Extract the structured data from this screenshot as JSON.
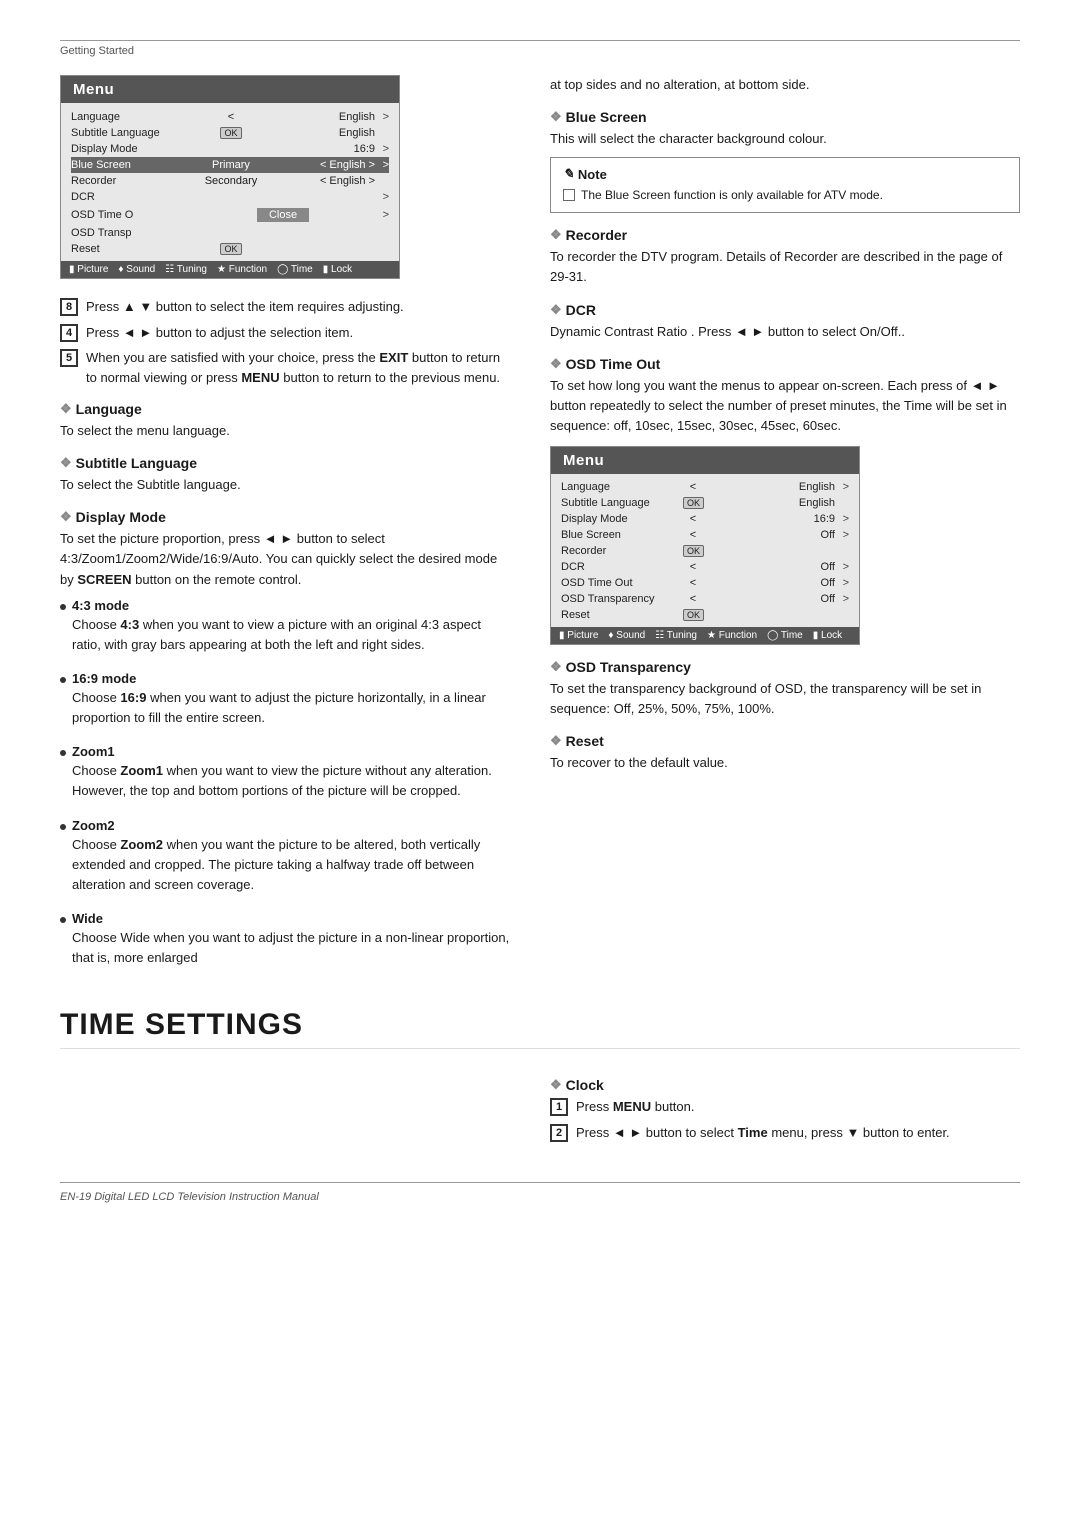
{
  "page": {
    "section_header": "Getting Started",
    "footer_text": "EN-19  Digital LED LCD Television Instruction Manual"
  },
  "menu1": {
    "title": "Menu",
    "rows": [
      {
        "label": "Language",
        "middle": "",
        "value": "English",
        "arrow": ">",
        "ok": false,
        "highlight": false
      },
      {
        "label": "Subtitle Language",
        "middle": "OK",
        "value": "English",
        "arrow": "",
        "ok": true,
        "highlight": false
      },
      {
        "label": "Display Mode",
        "middle": "",
        "value": "16:9",
        "arrow": ">",
        "ok": false,
        "highlight": false
      },
      {
        "label": "Blue Screen",
        "middle": "Primary",
        "value": "< English >",
        "arrow": ">",
        "ok": false,
        "highlight": true
      },
      {
        "label": "Recorder",
        "middle": "Secondary",
        "value": "< English >",
        "arrow": "",
        "ok": false,
        "highlight": false
      },
      {
        "label": "DCR",
        "middle": "",
        "value": "",
        "arrow": ">",
        "ok": false,
        "highlight": false
      },
      {
        "label": "OSD Time Out",
        "middle": "Close",
        "value": "",
        "arrow": ">",
        "ok": false,
        "highlight": false
      },
      {
        "label": "OSD Transparency",
        "middle": "",
        "value": "",
        "arrow": "",
        "ok": false,
        "highlight": false
      },
      {
        "label": "Reset",
        "middle": "OK",
        "value": "",
        "arrow": "",
        "ok": true,
        "highlight": false
      }
    ],
    "footer_items": [
      "Picture",
      "Sound",
      "Tuning",
      "Function",
      "Time",
      "Lock"
    ]
  },
  "steps": [
    {
      "num": "8",
      "text": "Press ▲ ▼ button to select the item requires adjusting."
    },
    {
      "num": "4",
      "text": "Press ◄ ► button to adjust the selection item."
    },
    {
      "num": "5",
      "text": "When you are satisfied with your choice, press the EXIT button to return to normal viewing or press MENU button to return to the previous menu."
    }
  ],
  "left_sections": [
    {
      "title": "Language",
      "body": "To select the menu language."
    },
    {
      "title": "Subtitle Language",
      "body": "To select the Subtitle language."
    },
    {
      "title": "Display Mode",
      "body": "To set the picture proportion, press ◄ ► button to select 4:3/Zoom1/Zoom2/Wide/16:9/Auto. You can quickly select the desired mode by SCREEN button on the remote control.",
      "sub_items": [
        {
          "title": "4:3 mode",
          "body": "Choose 4:3 when you want to view a picture with an original 4:3 aspect ratio, with gray bars appearing at both the left and right sides."
        },
        {
          "title": "16:9 mode",
          "body": "Choose 16:9 when you want to adjust the picture horizontally, in a linear proportion to fill the entire screen."
        },
        {
          "title": "Zoom1",
          "body": "Choose Zoom1 when you want to view the picture without any alteration. However, the top and bottom portions of the picture will be cropped."
        },
        {
          "title": "Zoom2",
          "body": "Choose Zoom2 when you want the picture to be altered, both vertically extended and cropped. The picture taking a halfway trade off between alteration and screen coverage."
        },
        {
          "title": "Wide",
          "body": "Choose Wide when you want to adjust the picture in a non-linear proportion, that is, more enlarged"
        }
      ]
    }
  ],
  "right_top_text": "at top sides and no alteration, at bottom side.",
  "right_sections": [
    {
      "title": "Blue Screen",
      "body": "This will select the character background colour.",
      "note": {
        "title": "Note",
        "items": [
          "The Blue Screen function is only available for ATV mode."
        ]
      }
    },
    {
      "title": "Recorder",
      "body": "To recorder the DTV program. Details of Recorder are described in the page of 29-31."
    },
    {
      "title": "DCR",
      "body": "Dynamic Contrast Ratio . Press ◄ ► button to select On/Off.."
    },
    {
      "title": "OSD Time Out",
      "body": "To set how long you want the menus to appear on-screen. Each press of ◄ ► button repeatedly to select the number of preset minutes, the Time will be set in sequence: off, 10sec, 15sec, 30sec, 45sec, 60sec."
    },
    {
      "title": "OSD Transparency",
      "body": "To set the transparency background of OSD, the transparency will be set in sequence: Off, 25%, 50%, 75%, 100%."
    },
    {
      "title": "Reset",
      "body": "To recover to the default value."
    }
  ],
  "menu2": {
    "title": "Menu",
    "rows": [
      {
        "label": "Language",
        "middle": "<",
        "value": "English",
        "arrow": ">"
      },
      {
        "label": "Subtitle Language",
        "middle": "OK",
        "value": "English",
        "arrow": ""
      },
      {
        "label": "Display Mode",
        "middle": "<",
        "value": "16:9",
        "arrow": ">"
      },
      {
        "label": "Blue Screen",
        "middle": "<",
        "value": "Off",
        "arrow": ">"
      },
      {
        "label": "Recorder",
        "middle": "OK",
        "value": "",
        "arrow": ""
      },
      {
        "label": "DCR",
        "middle": "<",
        "value": "Off",
        "arrow": ">"
      },
      {
        "label": "OSD Time Out",
        "middle": "<",
        "value": "Off",
        "arrow": ">"
      },
      {
        "label": "OSD Transparency",
        "middle": "<",
        "value": "Off",
        "arrow": ">"
      },
      {
        "label": "Reset",
        "middle": "OK",
        "value": "",
        "arrow": ""
      }
    ],
    "footer_items": [
      "Picture",
      "Sound",
      "Tuning",
      "Function",
      "Time",
      "Lock"
    ]
  },
  "big_section": {
    "title": "TIME SETTINGS"
  },
  "clock_section": {
    "title": "Clock",
    "steps": [
      {
        "num": "1",
        "text": "Press MENU button."
      },
      {
        "num": "2",
        "text": "Press ◄ ► button to select Time menu, press ▼ button to enter."
      }
    ]
  }
}
